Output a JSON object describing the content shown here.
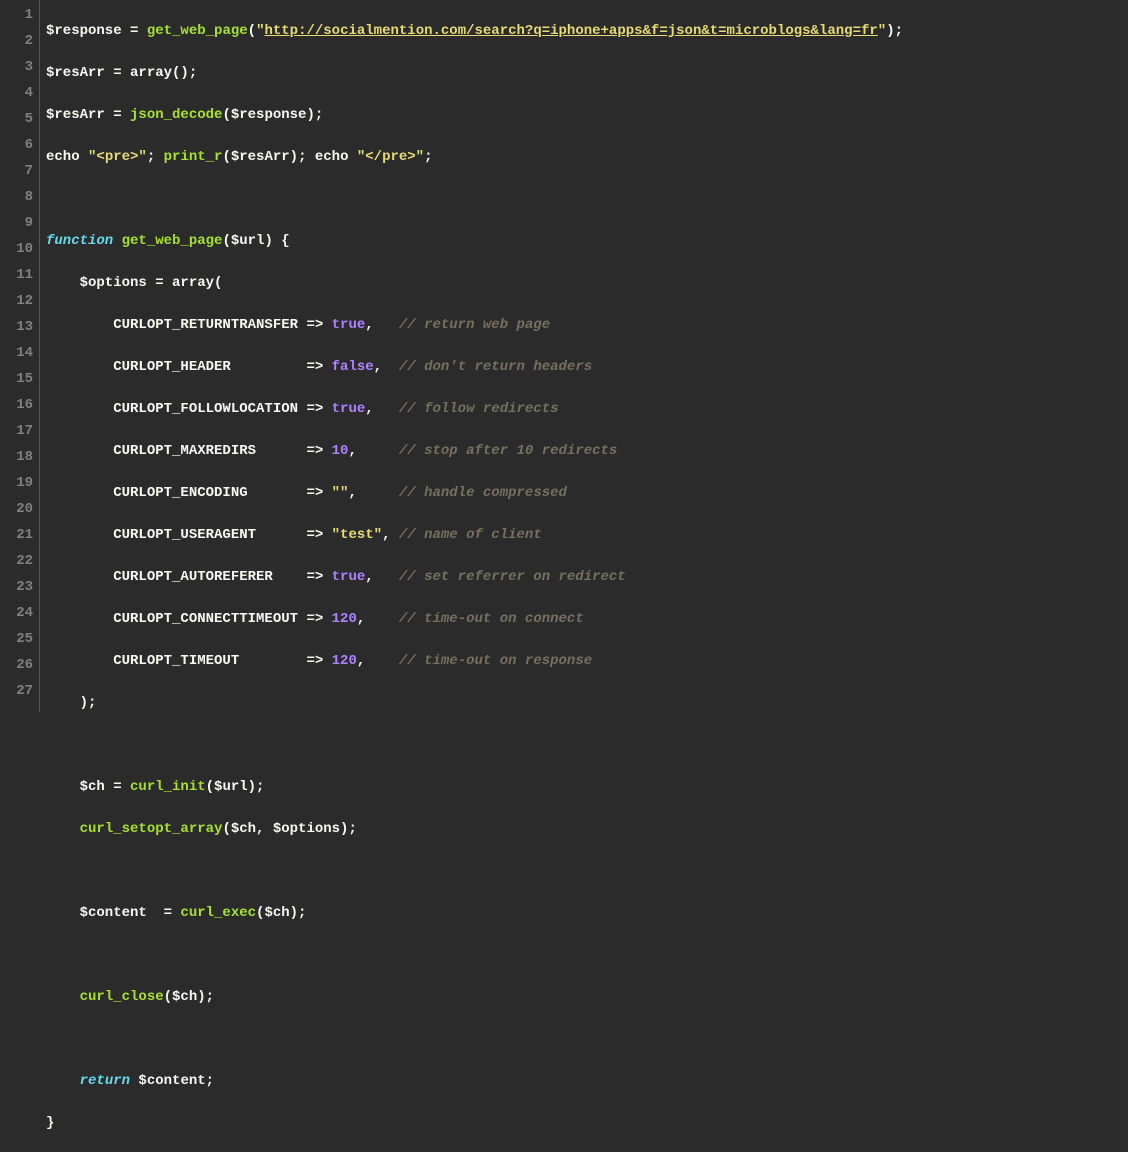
{
  "lineNumbers": [
    "1",
    "2",
    "3",
    "4",
    "5",
    "6",
    "7",
    "8",
    "9",
    "10",
    "11",
    "12",
    "13",
    "14",
    "15",
    "16",
    "17",
    "18",
    "19",
    "20",
    "21",
    "22",
    "23",
    "24",
    "25",
    "26",
    "27"
  ],
  "code": {
    "l1": {
      "a": "$response = ",
      "fn": "get_web_page",
      "b": "(",
      "q1": "\"",
      "url": "http://socialmention.com/search?q=iphone+apps&f=json&t=microblogs&lang=fr",
      "q2": "\"",
      "c": ");"
    },
    "l2": "$resArr = array();",
    "l3": {
      "a": "$resArr = ",
      "fn": "json_decode",
      "b": "($response);"
    },
    "l4": {
      "a": "echo ",
      "s1": "\"<pre>\"",
      "b": "; ",
      "fn": "print_r",
      "c": "($resArr); echo ",
      "s2": "\"</pre>\"",
      "d": ";"
    },
    "l6": {
      "kw": "function",
      "sp": " ",
      "fn": "get_web_page",
      "rest": "($url) {"
    },
    "l7": "    $options = array(",
    "l8": {
      "pad": "        CURLOPT_RETURNTRANSFER => ",
      "val": "true",
      "comma": ",   ",
      "cmt": "// return web page"
    },
    "l9": {
      "pad": "        CURLOPT_HEADER         => ",
      "val": "false",
      "comma": ",  ",
      "cmt": "// don't return headers"
    },
    "l10": {
      "pad": "        CURLOPT_FOLLOWLOCATION => ",
      "val": "true",
      "comma": ",   ",
      "cmt": "// follow redirects"
    },
    "l11": {
      "pad": "        CURLOPT_MAXREDIRS      => ",
      "val": "10",
      "comma": ",     ",
      "cmt": "// stop after 10 redirects"
    },
    "l12": {
      "pad": "        CURLOPT_ENCODING       => ",
      "val": "\"\"",
      "comma": ",     ",
      "cmt": "// handle compressed"
    },
    "l13": {
      "pad": "        CURLOPT_USERAGENT      => ",
      "val": "\"test\"",
      "comma": ", ",
      "cmt": "// name of client"
    },
    "l14": {
      "pad": "        CURLOPT_AUTOREFERER    => ",
      "val": "true",
      "comma": ",   ",
      "cmt": "// set referrer on redirect"
    },
    "l15": {
      "pad": "        CURLOPT_CONNECTTIMEOUT => ",
      "val": "120",
      "comma": ",    ",
      "cmt": "// time-out on connect"
    },
    "l16": {
      "pad": "        CURLOPT_TIMEOUT        => ",
      "val": "120",
      "comma": ",    ",
      "cmt": "// time-out on response"
    },
    "l17": "    );",
    "l19": {
      "a": "    $ch = ",
      "fn": "curl_init",
      "b": "($url);"
    },
    "l20": {
      "a": "    ",
      "fn": "curl_setopt_array",
      "b": "($ch, $options);"
    },
    "l22": {
      "a": "    $content  = ",
      "fn": "curl_exec",
      "b": "($ch);"
    },
    "l24": {
      "a": "    ",
      "fn": "curl_close",
      "b": "($ch);"
    },
    "l26": {
      "a": "    ",
      "kw": "return",
      "b": " $content;"
    },
    "l27": "}"
  }
}
